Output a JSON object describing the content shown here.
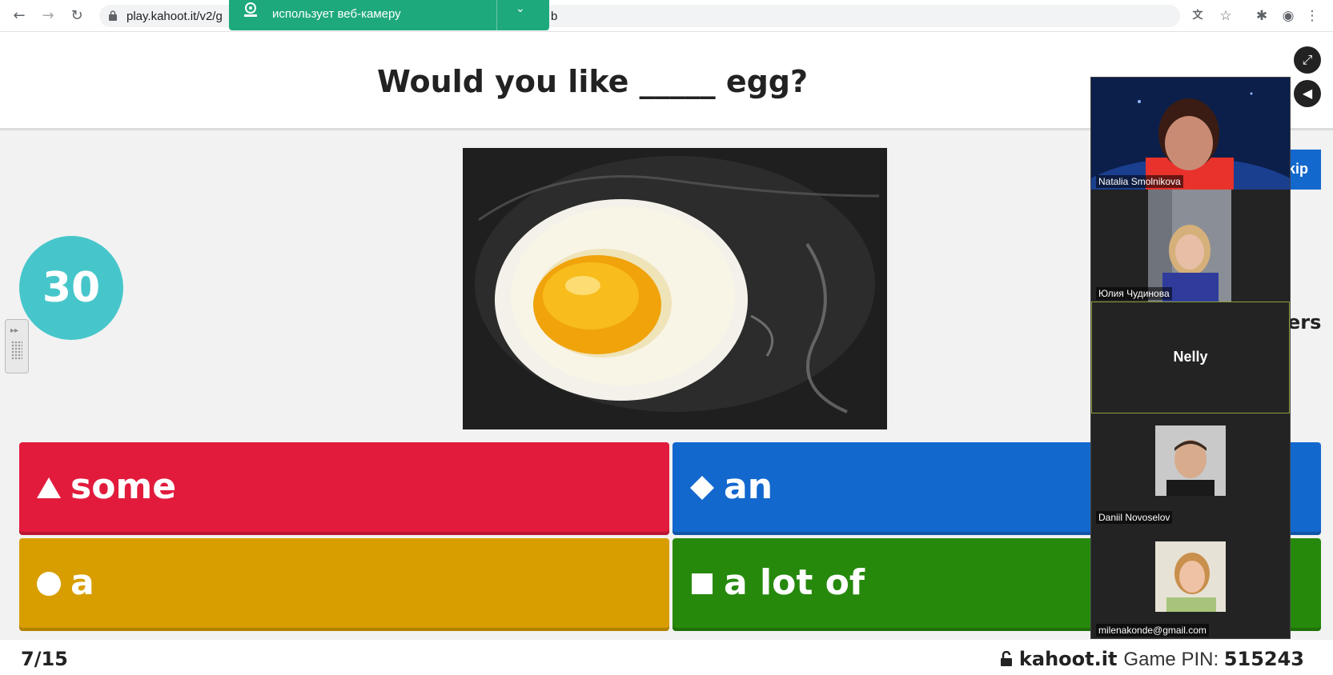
{
  "browser": {
    "url": "play.kahoot.it/v2/g",
    "url_tail": "b",
    "camera_notice": "использует веб-камеру"
  },
  "question": {
    "text": "Would you like _____ egg?",
    "timer": "30",
    "progress": "7/15",
    "skip_label": "kip",
    "answers_partial": "ers"
  },
  "answers": [
    {
      "shape": "triangle",
      "label": "some",
      "color": "#e21b3c"
    },
    {
      "shape": "diamond",
      "label": "an",
      "color": "#1368ce"
    },
    {
      "shape": "circle",
      "label": "a",
      "color": "#d89e00"
    },
    {
      "shape": "square",
      "label": "a lot of",
      "color": "#26890c"
    }
  ],
  "footer": {
    "brand": "kahoot.it",
    "pin_label": "Game PIN:",
    "pin_value": "515243"
  },
  "participants": [
    {
      "name": "Natalia Smolnikova",
      "video": true
    },
    {
      "name": "Юлия Чудинова",
      "video": true
    },
    {
      "name": "Nelly",
      "video": false
    },
    {
      "name": "Daniil Novoselov",
      "video": true
    },
    {
      "name": "milenakonde@gmail.com",
      "video": true
    }
  ],
  "icons": {
    "back": "back-arrow-icon",
    "forward": "forward-arrow-icon",
    "reload": "reload-icon",
    "lock": "lock-icon",
    "translate": "translate-icon",
    "star": "star-icon",
    "extensions": "puzzle-icon",
    "profile": "profile-icon",
    "menu": "kebab-menu-icon",
    "fullscreen": "fullscreen-icon",
    "sound": "speaker-icon"
  }
}
